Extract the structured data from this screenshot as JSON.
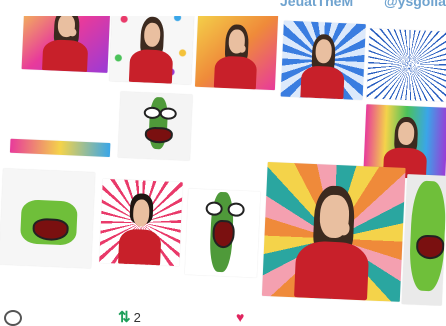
{
  "header": {
    "handle_partial": "JeuatTheM",
    "handle_partial_2": "@ysgoliad"
  },
  "footer": {
    "reply_icon": "reply-icon",
    "retweet_icon": "retweet-icon",
    "retweet_count": "2",
    "like_icon": "heart-icon"
  },
  "colors": {
    "sunburst_teal": "#2aa6a0",
    "sunburst_orange": "#ef8a3a",
    "sunburst_yellow": "#f4d34a",
    "pink_gradient": "#e83a9b",
    "blue_rays": "#3a7de0",
    "uniform_red": "#c8202a",
    "cucumber_green": "#4f9a3a",
    "retweet_green": "#1d9f5a",
    "like_red": "#e0245e"
  }
}
